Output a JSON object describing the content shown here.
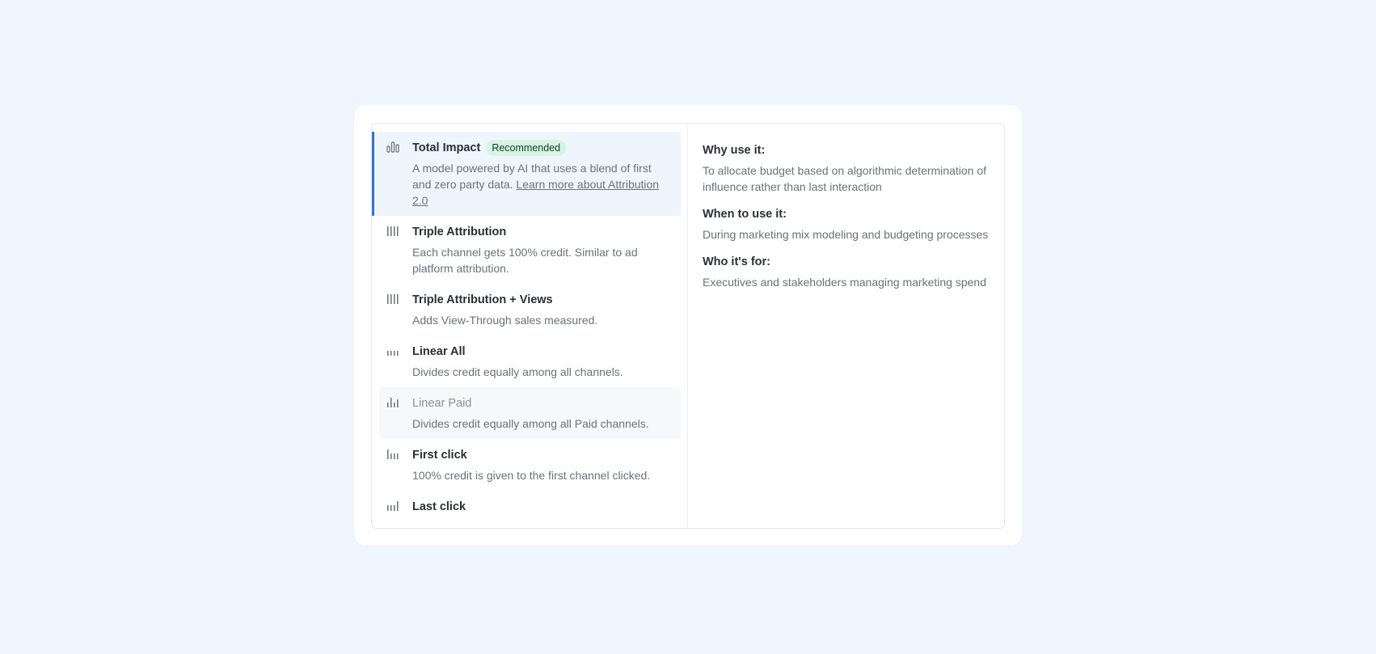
{
  "options": [
    {
      "title": "Total Impact",
      "badge": "Recommended",
      "description": "A model powered by AI that uses a blend of first and zero party data.",
      "link": "Learn more about Attribution 2.0",
      "icon": "bar-chart-icon",
      "state": "selected"
    },
    {
      "title": "Triple Attribution",
      "description": "Each channel gets 100% credit. Similar to ad platform attribution.",
      "icon": "equal-bars-icon"
    },
    {
      "title": "Triple Attribution + Views",
      "description": "Adds View-Through sales measured.",
      "icon": "equal-bars-icon"
    },
    {
      "title": "Linear All",
      "description": "Divides credit equally among all channels.",
      "icon": "short-bars-icon"
    },
    {
      "title": "Linear Paid",
      "description": "Divides credit equally among all Paid channels.",
      "icon": "mixed-bars-icon",
      "state": "hovered"
    },
    {
      "title": "First click",
      "description": "100% credit is given to the first channel clicked.",
      "icon": "first-bar-tall-icon"
    },
    {
      "title": "Last click",
      "description": "",
      "icon": "last-bar-tall-icon"
    }
  ],
  "details": {
    "why_heading": "Why use it:",
    "why_text": "To allocate budget based on algorithmic determination of influence rather than last interaction",
    "when_heading": "When to use it:",
    "when_text": "During marketing mix modeling and budgeting processes",
    "who_heading": "Who it's for:",
    "who_text": "Executives and stakeholders managing marketing spend"
  },
  "colors": {
    "background": "#eff6ff",
    "selected_accent": "#3b74c9",
    "selected_background": "#eff5fd",
    "badge_background": "#d5f5e3"
  }
}
